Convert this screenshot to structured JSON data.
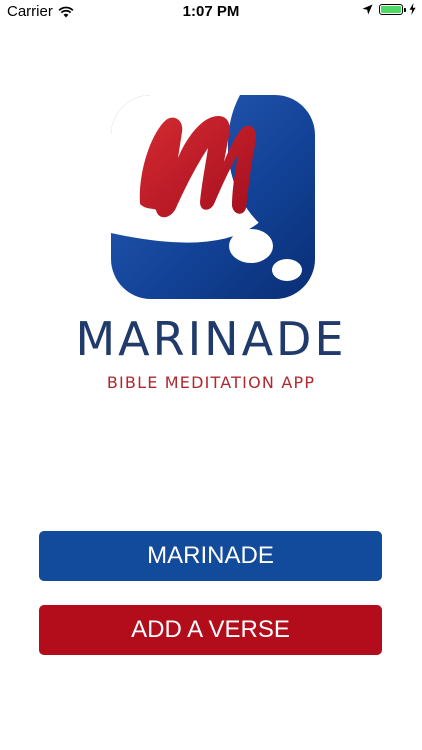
{
  "status_bar": {
    "carrier": "Carrier",
    "time": "1:07 PM",
    "battery_level": 1.0,
    "battery_color": "#4cd964"
  },
  "brand": {
    "name": "MARINADE",
    "tagline": "BIBLE MEDITATION APP",
    "name_color": "#1f3a6b",
    "tagline_color": "#b0282f",
    "logo_icon": "marinade-logo-icon"
  },
  "buttons": {
    "marinade": {
      "label": "MARINADE",
      "color": "#124a9c"
    },
    "add_verse": {
      "label": "ADD A VERSE",
      "color": "#b30d1c"
    }
  }
}
